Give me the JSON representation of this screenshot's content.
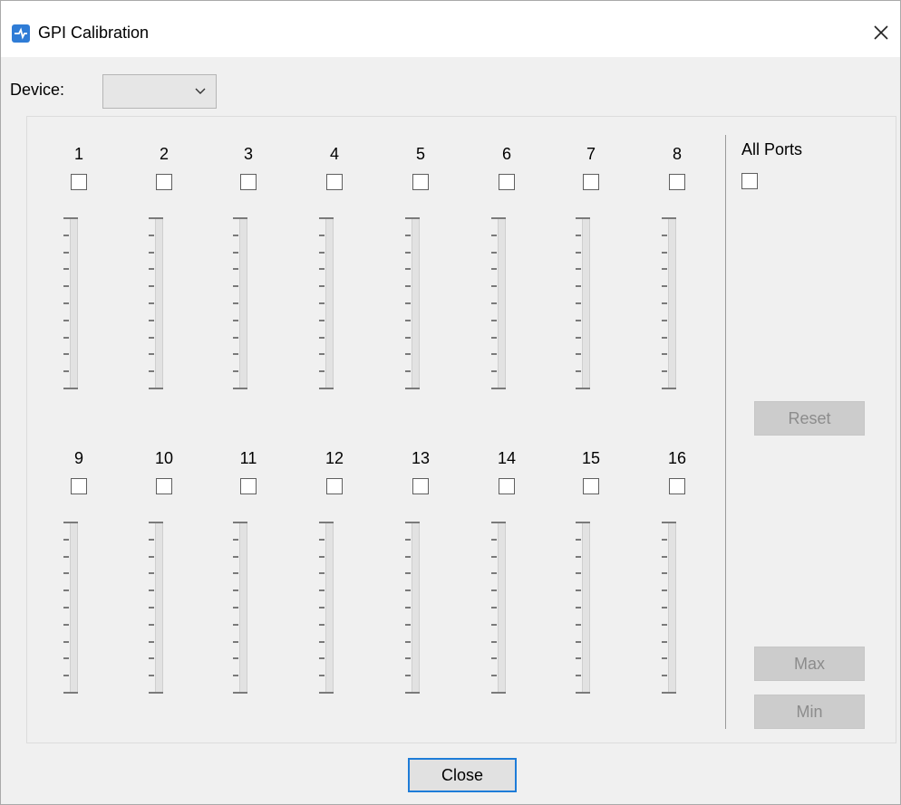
{
  "window": {
    "title": "GPI Calibration"
  },
  "device": {
    "label": "Device:",
    "value": ""
  },
  "ports": [
    {
      "label": "1"
    },
    {
      "label": "2"
    },
    {
      "label": "3"
    },
    {
      "label": "4"
    },
    {
      "label": "5"
    },
    {
      "label": "6"
    },
    {
      "label": "7"
    },
    {
      "label": "8"
    },
    {
      "label": "9"
    },
    {
      "label": "10"
    },
    {
      "label": "11"
    },
    {
      "label": "12"
    },
    {
      "label": "13"
    },
    {
      "label": "14"
    },
    {
      "label": "15"
    },
    {
      "label": "16"
    }
  ],
  "all_ports": {
    "label": "All Ports"
  },
  "buttons": {
    "reset": "Reset",
    "max": "Max",
    "min": "Min",
    "close": "Close"
  },
  "colors": {
    "accent": "#1e7cd8",
    "disabled_bg": "#cccccc",
    "disabled_text": "#8c8c8c"
  }
}
